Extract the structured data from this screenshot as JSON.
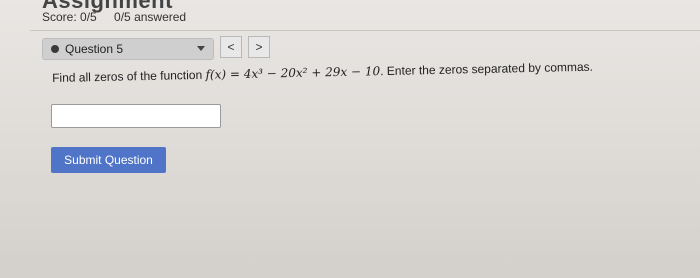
{
  "header": {
    "title": "Assignment",
    "score": "Score: 0/5",
    "answered": "0/5 answered"
  },
  "question_nav": {
    "selected": "Question 5",
    "prev_label": "<",
    "next_label": ">"
  },
  "question": {
    "prefix": "Find all zeros of the function ",
    "function": "f(x) = 4x³ − 20x² + 29x − 10",
    "suffix": ". Enter the zeros separated by commas."
  },
  "answer_input": {
    "value": "",
    "placeholder": ""
  },
  "submit_label": "Submit Question"
}
